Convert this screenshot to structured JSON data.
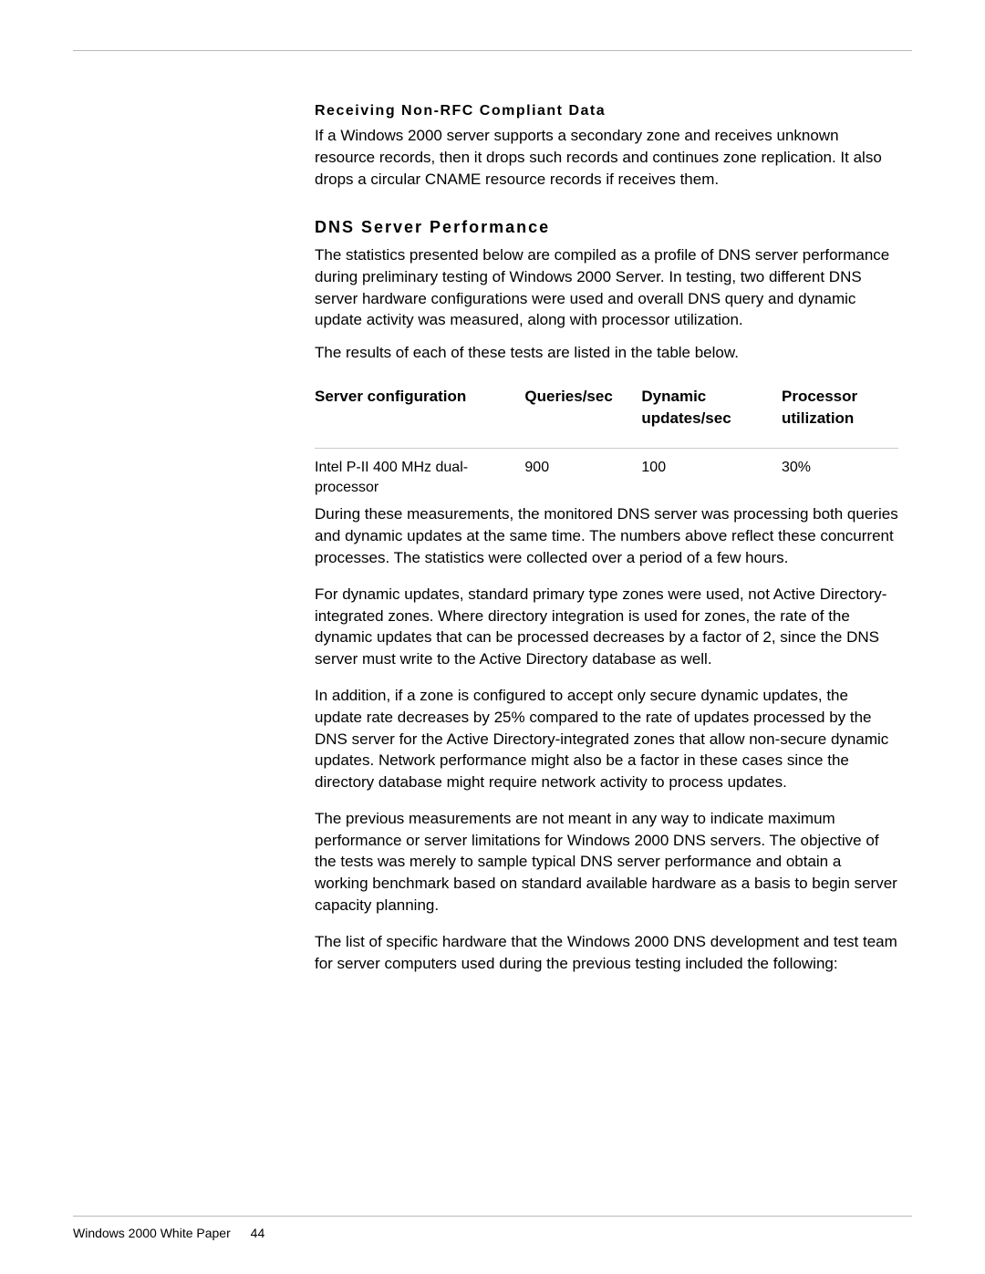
{
  "subheading": "Receiving Non-RFC Compliant Data",
  "para_nonrfc": "If a Windows 2000 server supports a secondary zone and receives unknown resource records, then it drops such records and continues zone replication. It also drops a circular CNAME resource records if receives them.",
  "section_heading": "DNS Server Performance",
  "para_perf_1": "The statistics presented below are compiled as a profile of DNS server performance during preliminary testing of Windows 2000 Server. In testing, two different DNS server hardware configurations were used and overall DNS query and dynamic update activity was measured, along with processor utilization.",
  "para_perf_2": "The results of each of these tests are listed in the table below.",
  "table": {
    "headers": {
      "c1": "Server configuration",
      "c2": "Queries/sec",
      "c3": "Dynamic updates/sec",
      "c4": "Processor utilization"
    },
    "rows": [
      {
        "c1": "Intel P-II 400 MHz dual-processor",
        "c2": "900",
        "c3": "100",
        "c4": "30%"
      }
    ]
  },
  "para_after_1": "During these measurements, the monitored DNS server was processing both queries and dynamic updates at the same time. The numbers above reflect these concurrent processes. The statistics were collected over a period of a few hours.",
  "para_after_2": "For dynamic updates, standard primary type zones were used, not Active Directory-integrated zones. Where directory integration is used for zones, the rate of the dynamic updates that can be processed decreases by a factor of 2, since the DNS server must write to the Active Directory database as well.",
  "para_after_3": "In addition, if a zone is configured to accept only secure dynamic updates, the update rate decreases by 25% compared to the rate of updates processed by the DNS server for the Active Directory-integrated zones that allow non-secure dynamic updates. Network performance might also be a factor in these cases since the directory database might require network activity to process updates.",
  "para_after_4": "The previous measurements are not meant in any way to indicate maximum performance or server limitations for Windows 2000 DNS servers. The objective of the tests was merely to sample typical DNS server performance and obtain a working benchmark based on standard available hardware as a basis to begin server capacity planning.",
  "para_after_5": "The list of specific hardware that the Windows 2000 DNS development and test team for server computers used during the previous testing included the following:",
  "footer": {
    "title": "Windows 2000 White Paper",
    "page": "44"
  }
}
